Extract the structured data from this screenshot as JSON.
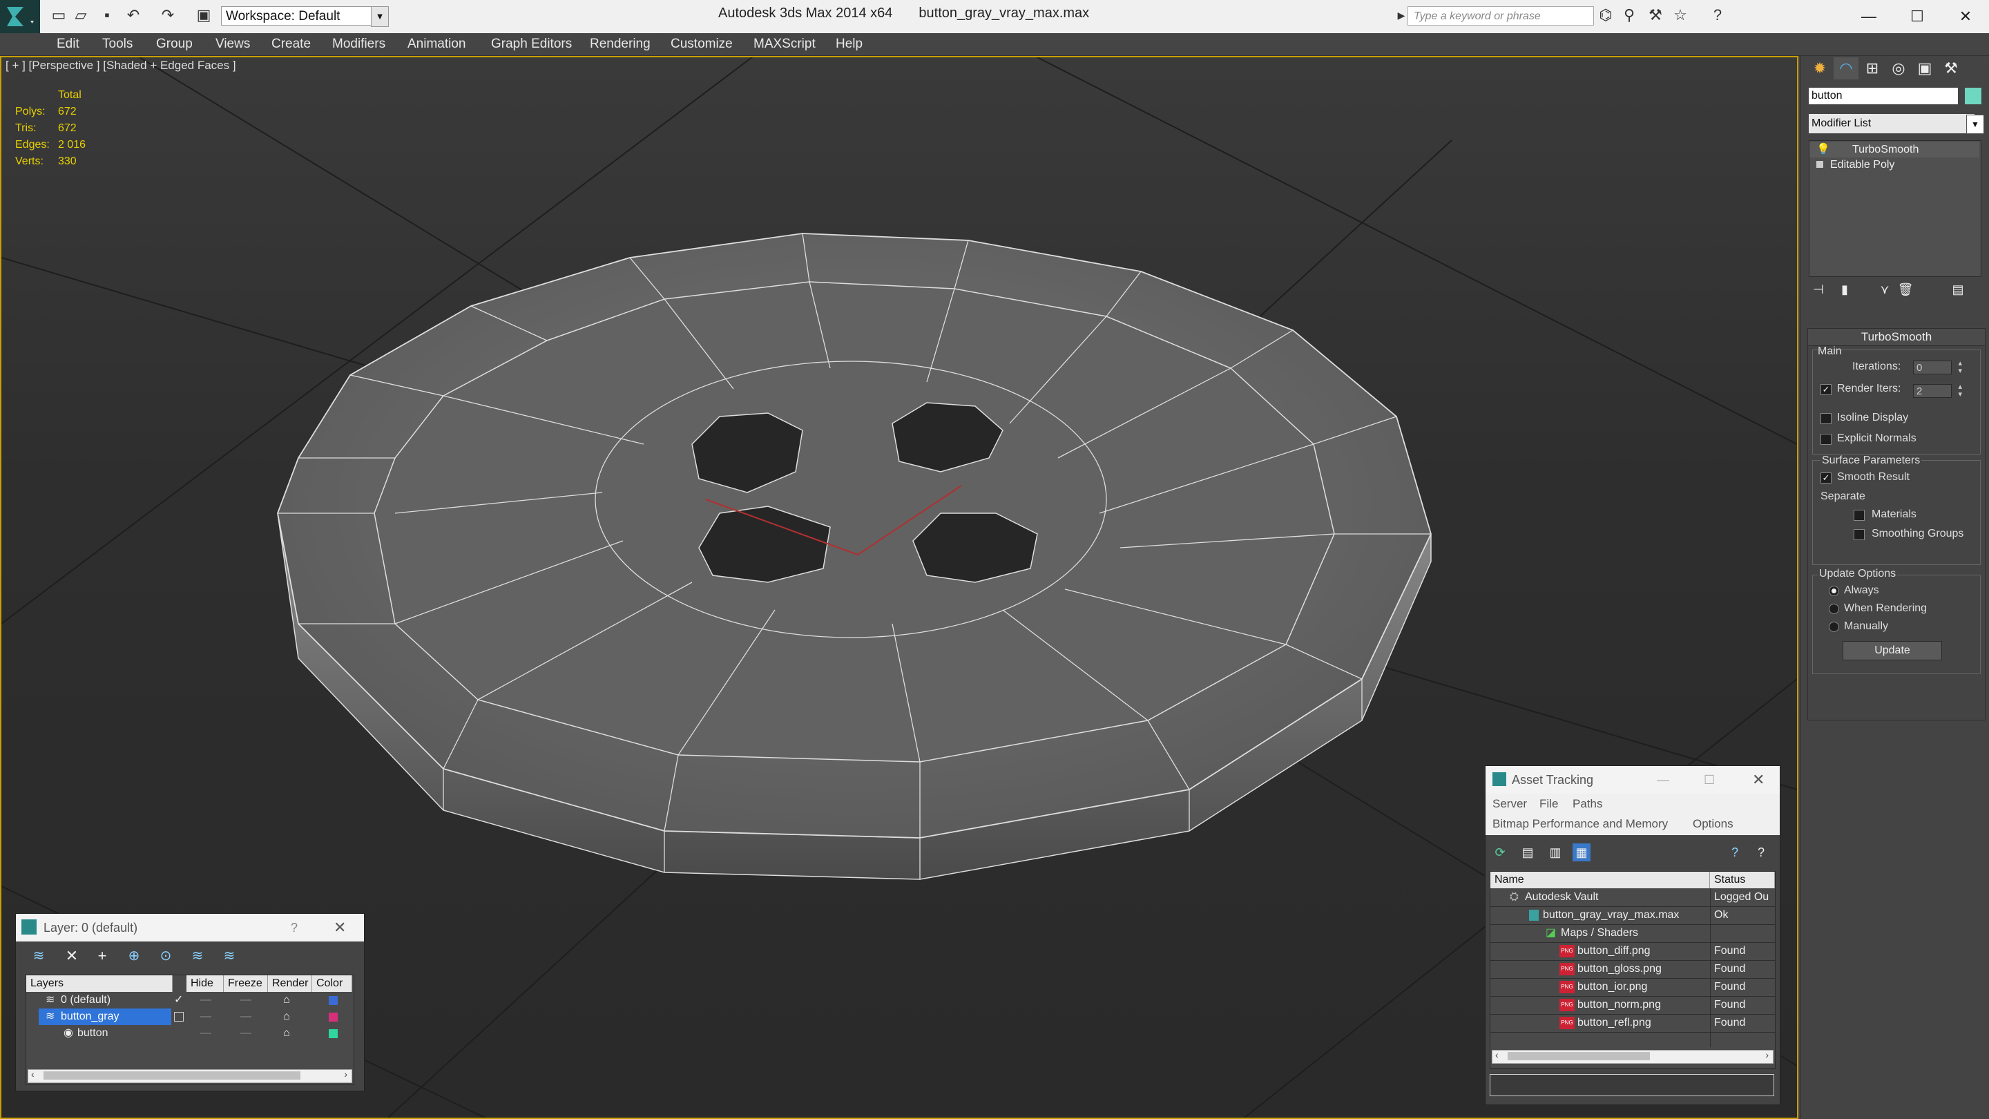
{
  "window": {
    "app_title": "Autodesk 3ds Max  2014 x64",
    "file_name": "button_gray_vray_max.max",
    "workspace": "Workspace: Default",
    "search_placeholder": "Type a keyword or phrase"
  },
  "menu": [
    "Edit",
    "Tools",
    "Group",
    "Views",
    "Create",
    "Modifiers",
    "Animation",
    "Graph Editors",
    "Rendering",
    "Customize",
    "MAXScript",
    "Help"
  ],
  "viewport": {
    "label": "[ + ] [Perspective ] [Shaded + Edged Faces ]",
    "stats": {
      "header": "Total",
      "polys_label": "Polys:",
      "polys": "672",
      "tris_label": "Tris:",
      "tris": "672",
      "edges_label": "Edges:",
      "edges": "2 016",
      "verts_label": "Verts:",
      "verts": "330"
    }
  },
  "command_panel": {
    "object_name": "button",
    "object_color": "#6fd6bf",
    "modifier_list": "Modifier List",
    "stack": [
      "TurboSmooth",
      "Editable Poly"
    ],
    "rollout_title": "TurboSmooth",
    "main_group": "Main",
    "iterations_label": "Iterations:",
    "iterations_value": "0",
    "render_iters_label": "Render Iters:",
    "render_iters_value": "2",
    "render_iters_checked": true,
    "isoline_label": "Isoline Display",
    "explicit_normals_label": "Explicit Normals",
    "surface_params": "Surface Parameters",
    "smooth_result": "Smooth Result",
    "separate": "Separate",
    "materials": "Materials",
    "smoothing_groups": "Smoothing Groups",
    "update_options": "Update Options",
    "always": "Always",
    "when_rendering": "When Rendering",
    "manually": "Manually",
    "update_button": "Update"
  },
  "layer_window": {
    "title": "Layer: 0 (default)",
    "help": "?",
    "columns": [
      "Layers",
      "Hide",
      "Freeze",
      "Render",
      "Color"
    ],
    "rows": [
      {
        "name": "0 (default)",
        "color": "#3a6bd6"
      },
      {
        "name": "button_gray",
        "color": "#d6307a"
      },
      {
        "name": "button",
        "color": "#30d6a0"
      }
    ]
  },
  "asset_window": {
    "title": "Asset Tracking",
    "menu": [
      "Server",
      "File",
      "Paths"
    ],
    "submenu_left": "Bitmap Performance and Memory",
    "submenu_right": "Options",
    "columns": [
      "Name",
      "Status"
    ],
    "rows": [
      {
        "name": "Autodesk Vault",
        "status": "Logged Ou"
      },
      {
        "name": "button_gray_vray_max.max",
        "status": "Ok"
      },
      {
        "name": "Maps / Shaders",
        "status": ""
      },
      {
        "name": "button_diff.png",
        "status": "Found"
      },
      {
        "name": "button_gloss.png",
        "status": "Found"
      },
      {
        "name": "button_ior.png",
        "status": "Found"
      },
      {
        "name": "button_norm.png",
        "status": "Found"
      },
      {
        "name": "button_refl.png",
        "status": "Found"
      }
    ]
  }
}
